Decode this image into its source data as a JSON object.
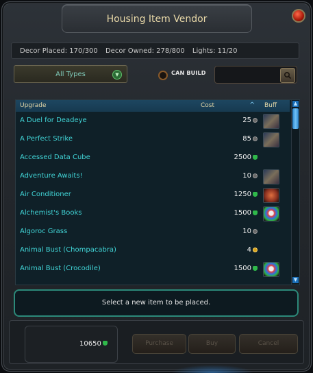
{
  "window": {
    "title": "Housing Item Vendor"
  },
  "stats": {
    "decor_placed": "Decor Placed: 170/300",
    "decor_owned": "Decor Owned: 278/800",
    "lights": "Lights: 11/20"
  },
  "filter": {
    "type_value": "All Types",
    "can_build_label": "CAN BUILD"
  },
  "search": {
    "value": ""
  },
  "table": {
    "headers": {
      "upgrade": "Upgrade",
      "cost": "Cost",
      "buff": "Buff"
    },
    "rows": [
      {
        "name": "A Duel for Deadeye",
        "cost": "25",
        "currency": "gray-coin-icon",
        "buff": "armor-icon"
      },
      {
        "name": "A Perfect Strike",
        "cost": "85",
        "currency": "gray-coin-icon",
        "buff": "armor-icon"
      },
      {
        "name": "Accessed Data Cube",
        "cost": "2500",
        "currency": "green-renown-icon",
        "buff": ""
      },
      {
        "name": "Adventure Awaits!",
        "cost": "10",
        "currency": "gray-coin-icon",
        "buff": "armor-icon"
      },
      {
        "name": "Air Conditioner",
        "cost": "1250",
        "currency": "green-renown-icon",
        "buff": "creature-icon"
      },
      {
        "name": "Alchemist's Books",
        "cost": "1500",
        "currency": "green-renown-icon",
        "buff": "colorful-orb-icon"
      },
      {
        "name": "Algoroc Grass",
        "cost": "10",
        "currency": "gray-coin-icon",
        "buff": ""
      },
      {
        "name": "Animal Bust (Chompacabra)",
        "cost": "4",
        "currency": "gold-coin-icon",
        "buff": ""
      },
      {
        "name": "Animal Bust (Crocodile)",
        "cost": "1500",
        "currency": "green-renown-icon",
        "buff": "colorful-orb-icon"
      }
    ]
  },
  "status": {
    "message": "Select a new item to be placed."
  },
  "footer": {
    "currency_amount": "10650",
    "purchase_label": "Purchase",
    "buy_label": "Buy",
    "cancel_label": "Cancel"
  }
}
